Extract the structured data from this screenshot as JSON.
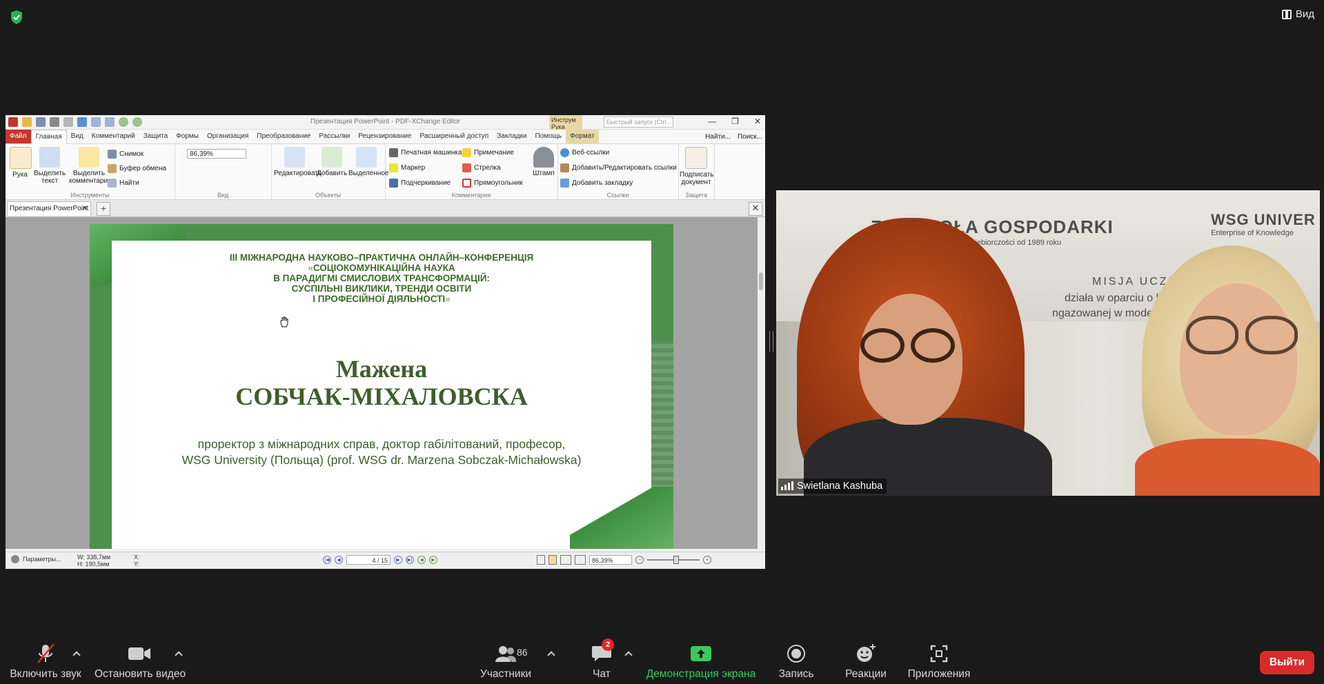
{
  "zoom_top": {
    "view_label": "Вид"
  },
  "pdf": {
    "window_title": "Презентация PowerPoint - PDF-XChange Editor",
    "search_placeholder": "Быстрый запуск (Ctrl...",
    "tool_tab": "Инструм Рука",
    "menu": {
      "file": "Файл",
      "home": "Главная",
      "view": "Вид",
      "comment": "Комментарий",
      "protect": "Защита",
      "forms": "Формы",
      "organize": "Организация",
      "convert": "Преобразование",
      "mailing": "Рассылки",
      "review": "Рецензирование",
      "share": "Расширенный доступ",
      "bookmarks": "Закладки",
      "help": "Помощь",
      "format": "Формат",
      "find": "Найти...",
      "search": "Поиск..."
    },
    "ribbon": {
      "hand": "Рука",
      "select_text": "Выделить текст",
      "select_comments": "Выделить комментарии",
      "snapshot": "Снимок",
      "clipboard": "Буфер обмена",
      "find": "Найти",
      "g_tools": "Инструменты",
      "zoom_value": "86,39%",
      "g_view": "Вид",
      "edit": "Редактировать",
      "add": "Добавить",
      "selected": "Выделенное",
      "g_objects": "Объекты",
      "typewriter": "Печатная машинка",
      "note": "Примечание",
      "marker": "Маркер",
      "arrow": "Стрелка",
      "underline": "Подчеркивание",
      "rectangle": "Прямоугольник",
      "stamp": "Штамп",
      "g_comments": "Комментарии",
      "web_links": "Веб-ссылки",
      "edit_links": "Добавить/Редактировать ссылки",
      "add_bookmark": "Добавить закладку",
      "g_links": "Ссылки",
      "sign": "Подписать документ",
      "g_protect": "Защита"
    },
    "doc_tab": "Презентация PowerPoint",
    "slide": {
      "conf_line1": "ІІІ МІЖНАРОДНА НАУКОВО–ПРАКТИЧНА ОНЛАЙН–КОНФЕРЕНЦІЯ",
      "conf_line2": "СОЦІОКОМУНІКАЦІЙНА НАУКА",
      "conf_line3": "В ПАРАДИГМІ СМИСЛОВИХ ТРАНСФОРМАЦІЙ:",
      "conf_line4": "СУСПІЛЬНІ ВИКЛИКИ, ТРЕНДИ ОСВІТИ",
      "conf_line5": "І ПРОФЕСІЙНОЇ ДІЯЛЬНОСТІ",
      "quote_open": "«",
      "quote_close": "»",
      "name_first": "Мажена",
      "name_last": "СОБЧАК-МІХАЛОВСКА",
      "desc_line1": "проректор з міжнародних справ, доктор габілітований, професор,",
      "desc_line2": "WSG University (Польща) (prof. WSG dr. Marzena Sobczak-Michałowska)"
    },
    "status": {
      "params": "Параметры...",
      "w": "W: 338,7мм",
      "h": "H: 190,5мм",
      "x": "X:",
      "y": "Y:",
      "page": "4",
      "page_total": "/ 15",
      "zoom": "86,39%"
    }
  },
  "video": {
    "participant_name": "Swietlana Kashuba",
    "wall_text_1": "ZA SZKOŁA GOSPODARKI",
    "wall_text_2": "WSG UNIVER",
    "wall_text_3": "Enterprise of Knowledge",
    "wall_text_4": "MISJA UCZEL",
    "wall_text_5": "działa w oparciu o ko",
    "wall_text_6": "ngazowanej w mode",
    "wall_text_7": "u Przedsiębiorczości od 1989 roku"
  },
  "toolbar": {
    "unmute": "Включить звук",
    "stop_video": "Остановить видео",
    "participants": "Участники",
    "participants_count": "86",
    "chat": "Чат",
    "chat_badge": "2",
    "share_screen": "Демонстрация экрана",
    "record": "Запись",
    "reactions": "Реакции",
    "apps": "Приложения",
    "leave": "Выйти"
  },
  "colors": {
    "share_green": "#3cc95a",
    "leave_red": "#d92b2b",
    "slide_green": "#3b6b2a"
  }
}
